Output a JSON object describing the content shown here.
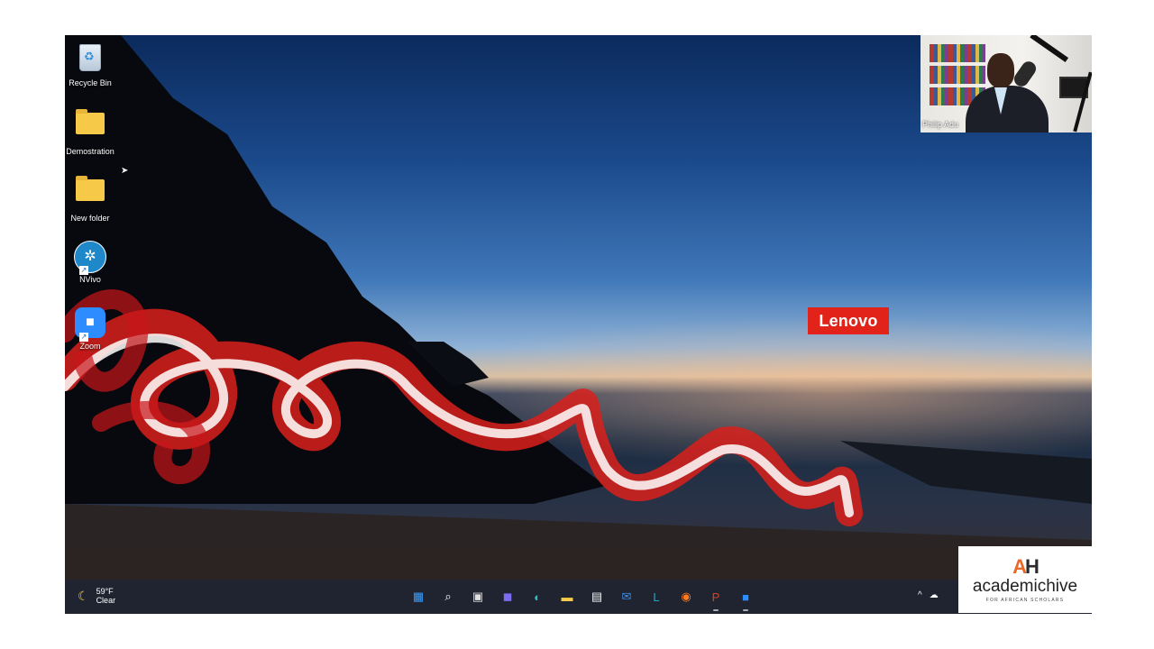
{
  "desktop": {
    "icons": [
      {
        "label": "Recycle Bin"
      },
      {
        "label": "Demostration"
      },
      {
        "label": "New folder"
      },
      {
        "label": "NVivo"
      },
      {
        "label": "Zoom"
      }
    ],
    "wallpaper_brand": "Lenovo"
  },
  "webcam": {
    "participant_name": "Philip Adu"
  },
  "taskbar": {
    "weather": {
      "temperature": "59°F",
      "condition": "Clear"
    },
    "apps": [
      {
        "name": "start-icon",
        "glyph": "▦",
        "color": "#3aa0ff"
      },
      {
        "name": "search-icon",
        "glyph": "⌕",
        "color": "#ffffff"
      },
      {
        "name": "task-view-icon",
        "glyph": "▣",
        "color": "#e0e0e0"
      },
      {
        "name": "teams-chat-icon",
        "glyph": "◼",
        "color": "#7b6cf0"
      },
      {
        "name": "edge-icon",
        "glyph": "◐",
        "color": "#2cc0c8"
      },
      {
        "name": "file-explorer-icon",
        "glyph": "▬",
        "color": "#f6c948"
      },
      {
        "name": "microsoft-store-icon",
        "glyph": "▤",
        "color": "#f4f4f4"
      },
      {
        "name": "mail-icon",
        "glyph": "✉",
        "color": "#3a8ee6"
      },
      {
        "name": "lenovo-vantage-icon",
        "glyph": "L",
        "color": "#2aa5c0"
      },
      {
        "name": "firefox-icon",
        "glyph": "◉",
        "color": "#ff7a1a"
      },
      {
        "name": "powerpoint-icon",
        "glyph": "P",
        "color": "#d0452a"
      },
      {
        "name": "zoom-app-icon",
        "glyph": "■",
        "color": "#2d8cff"
      }
    ]
  },
  "watermark": {
    "mark_left": "A",
    "mark_right": "H",
    "name": "academichive",
    "tagline": "FOR AFRICAN SCHOLARS"
  },
  "colors": {
    "lenovo_red": "#e2231a",
    "accent_orange": "#e8692a",
    "taskbar": "#1f2430"
  }
}
